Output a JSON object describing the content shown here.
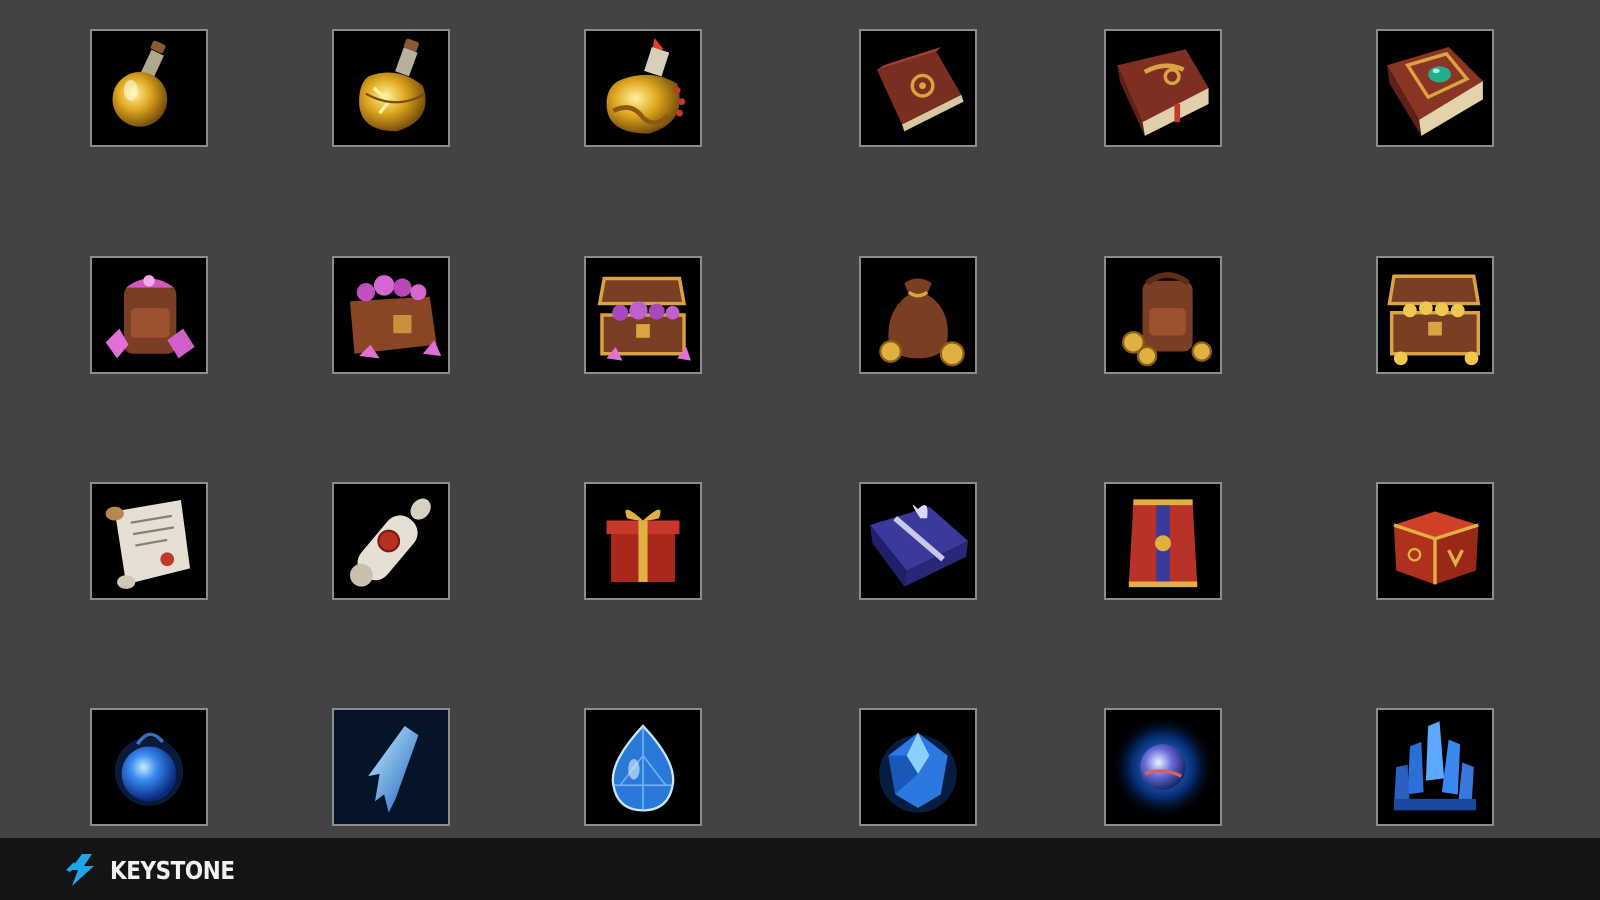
{
  "brand": {
    "name": "KEYSTONE",
    "accent": "#1fa6e8"
  },
  "colors": {
    "background": "#434343",
    "tile_bg": "#000000",
    "tile_border": "#8c8c8c",
    "footer_bg": "#141414"
  },
  "items": [
    {
      "icon": "small-gold-potion-icon"
    },
    {
      "icon": "medium-gold-potion-icon"
    },
    {
      "icon": "large-gold-potion-icon"
    },
    {
      "icon": "small-red-tome-icon"
    },
    {
      "icon": "medium-red-tome-icon"
    },
    {
      "icon": "large-jeweled-tome-icon"
    },
    {
      "icon": "gem-backpack-icon"
    },
    {
      "icon": "gem-satchel-icon"
    },
    {
      "icon": "gem-chest-icon"
    },
    {
      "icon": "coin-pouch-icon"
    },
    {
      "icon": "coin-backpack-icon"
    },
    {
      "icon": "coin-chest-icon"
    },
    {
      "icon": "open-scroll-icon"
    },
    {
      "icon": "sealed-scroll-icon"
    },
    {
      "icon": "red-gift-box-icon"
    },
    {
      "icon": "blue-gift-box-icon"
    },
    {
      "icon": "tall-red-crate-icon"
    },
    {
      "icon": "red-gold-crate-icon"
    },
    {
      "icon": "blue-orb-icon"
    },
    {
      "icon": "ice-shard-icon"
    },
    {
      "icon": "blue-teardrop-gem-icon"
    },
    {
      "icon": "blue-crystal-gem-icon"
    },
    {
      "icon": "glowing-planet-orb-icon"
    },
    {
      "icon": "crystal-cluster-icon"
    }
  ]
}
